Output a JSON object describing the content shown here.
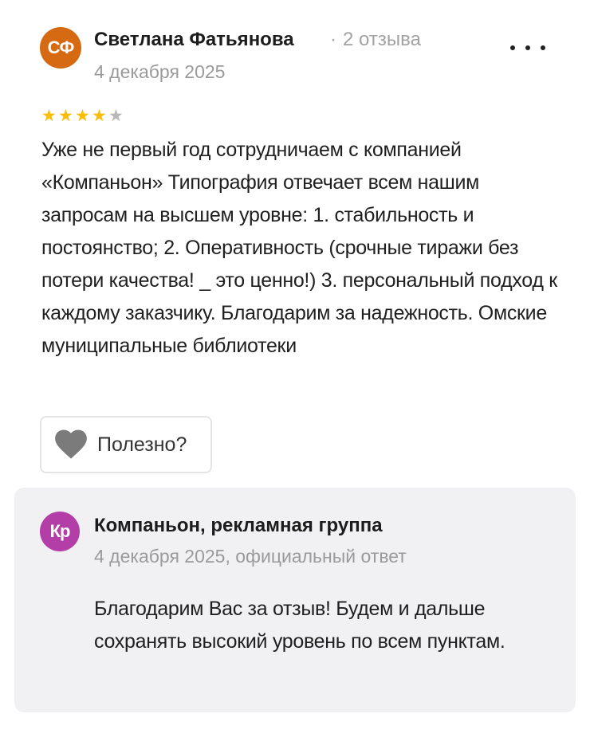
{
  "review": {
    "author": {
      "initials": "СФ",
      "name": "Светлана Фатьянова",
      "reviews_count": "2 отзыва",
      "avatar_color": "#d66a12"
    },
    "date": "4 декабря 2025",
    "rating": 4,
    "rating_max": 5,
    "text": "Уже не первый год сотрудничаем с компанией «Компаньон» Типография отвечает всем нашим запросам на высшем уровне: 1. стабильность и постоянство; 2. Оперативность (срочные тиражи без потери качества! _ это ценно!) 3. персональный подход к каждому заказчику. Благодарим за надежность. Омские муниципальные библиотеки",
    "useful_button": {
      "icon": "heart-icon",
      "label": "Полезно?"
    },
    "more_icon": "more-dots-icon"
  },
  "reply": {
    "company": {
      "initials": "Кр",
      "name": "Компаньон, рекламная группа",
      "avatar_color": "#b43ea8"
    },
    "meta": "4 декабря 2025, официальный ответ",
    "text": "Благодарим Вас за отзыв! Будем и дальше сохранять высокий уровень по всем пунктам."
  },
  "colors": {
    "star_active": "#fcbd08",
    "star_inactive": "#b8b8b8",
    "reply_background": "#f1f1f3",
    "muted_text": "#9a9a9a"
  }
}
